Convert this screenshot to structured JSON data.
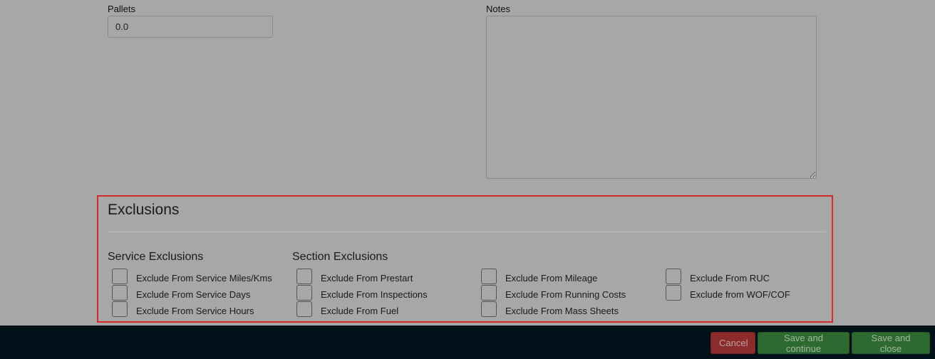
{
  "pallets": {
    "label": "Pallets",
    "value": "0.0"
  },
  "notes": {
    "label": "Notes",
    "value": ""
  },
  "exclusions": {
    "title": "Exclusions",
    "service_heading": "Service Exclusions",
    "section_heading": "Section Exclusions",
    "service_items": [
      "Exclude From Service Miles/Kms",
      "Exclude From Service Days",
      "Exclude From Service Hours"
    ],
    "section_col1": [
      "Exclude From Prestart",
      "Exclude From Inspections",
      "Exclude From Fuel"
    ],
    "section_col2": [
      "Exclude From Mileage",
      "Exclude From Running Costs",
      "Exclude From Mass Sheets"
    ],
    "section_col3": [
      "Exclude From RUC",
      "Exclude from WOF/COF"
    ]
  },
  "footer": {
    "cancel_label": "Cancel",
    "save_continue_label": "Save and continue",
    "save_close_label": "Save and close"
  },
  "colors": {
    "background": "#a7a7a7",
    "highlight_border": "#d9282a",
    "footer_bg": "#00111a",
    "cancel_bg": "#8c2b2b",
    "save_bg": "#2c6a2f"
  }
}
